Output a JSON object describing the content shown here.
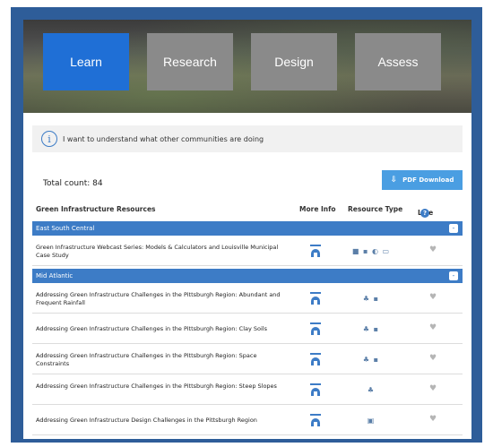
{
  "tabs": [
    {
      "label": "Learn",
      "active": true
    },
    {
      "label": "Research",
      "active": false
    },
    {
      "label": "Design",
      "active": false
    },
    {
      "label": "Assess",
      "active": false
    }
  ],
  "intent": {
    "icon": "info-icon",
    "text": "I want to understand what other communities are doing"
  },
  "total_count": "Total count: 84",
  "pdf_button": {
    "label": "PDF Download",
    "icon": "download-icon"
  },
  "table_headers": {
    "resources": "Green Infrastructure Resources",
    "more_info": "More Info",
    "resource_type": "Resource Type",
    "like": "Like",
    "like_help_icon": "?"
  },
  "sections": [
    {
      "name": "East South Central",
      "toggle": "-",
      "rows": [
        {
          "title": "Green Infrastructure Webcast Series: Models & Calculators and Louisville Municipal Case Study",
          "resource_icons": "■ ▪ ◐ ▭"
        }
      ]
    },
    {
      "name": "Mid Atlantic",
      "toggle": "-",
      "rows": [
        {
          "title": "Addressing Green Infrastructure Challenges in the Pittsburgh Region: Abundant and Frequent Rainfall",
          "resource_icons": "♣ ▪"
        },
        {
          "title": "Addressing Green Infrastructure Challenges in the Pittsburgh Region: Clay Soils",
          "resource_icons": "♣ ▪"
        },
        {
          "title": "Addressing Green Infrastructure Challenges in the Pittsburgh Region: Space Constraints",
          "resource_icons": "♣ ▪"
        },
        {
          "title": "Addressing Green Infrastructure Challenges in the Pittsburgh Region: Steep Slopes",
          "resource_icons": "♣"
        },
        {
          "title": "Addressing Green Infrastructure Design Challenges in the Pittsburgh Region",
          "resource_icons": "▣"
        }
      ]
    }
  ],
  "colors": {
    "accent": "#1f6fd6",
    "section": "#3d7cc6",
    "frame": "#2e5d99",
    "inactive_tab": "#8a8a8a"
  }
}
